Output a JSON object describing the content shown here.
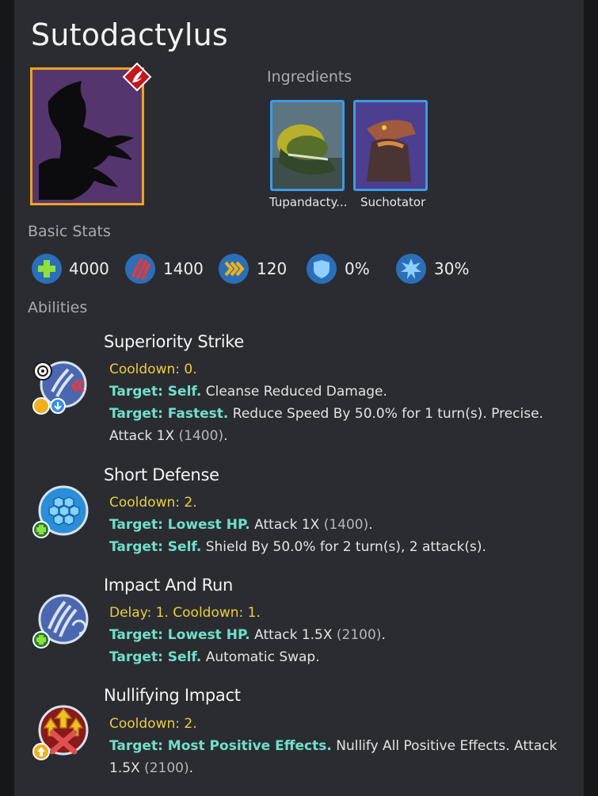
{
  "creature": {
    "name": "Sutodactylus"
  },
  "sections": {
    "ingredients": "Ingredients",
    "basic_stats": "Basic Stats",
    "abilities": "Abilities"
  },
  "ingredients": [
    {
      "name": "Tupandacty..."
    },
    {
      "name": "Suchotator"
    }
  ],
  "stats": [
    {
      "icon": "health-icon",
      "value": "4000"
    },
    {
      "icon": "attack-icon",
      "value": "1400"
    },
    {
      "icon": "speed-icon",
      "value": "120"
    },
    {
      "icon": "armor-icon",
      "value": "0%"
    },
    {
      "icon": "critical-icon",
      "value": "30%"
    }
  ],
  "abilities": [
    {
      "name": "Superiority Strike",
      "timing": "Cooldown: 0.",
      "lines": [
        {
          "target": "Target: Self.",
          "text": " Cleanse Reduced Damage.",
          "num": "",
          "tail": ""
        },
        {
          "target": "Target: Fastest.",
          "text": " Reduce Speed By 50.0% for 1 turn(s). Precise. Attack 1X ",
          "num": "(1400)",
          "tail": "."
        }
      ]
    },
    {
      "name": "Short Defense",
      "timing": "Cooldown: 2.",
      "lines": [
        {
          "target": "Target: Lowest HP.",
          "text": " Attack 1X ",
          "num": "(1400)",
          "tail": "."
        },
        {
          "target": "Target: Self.",
          "text": " Shield By 50.0% for 2 turn(s), 2 attack(s).",
          "num": "",
          "tail": ""
        }
      ]
    },
    {
      "name": "Impact And Run",
      "timing": "Delay: 1. Cooldown: 1.",
      "lines": [
        {
          "target": "Target: Lowest HP.",
          "text": " Attack 1.5X ",
          "num": "(2100)",
          "tail": "."
        },
        {
          "target": "Target: Self.",
          "text": " Automatic Swap.",
          "num": "",
          "tail": ""
        }
      ]
    },
    {
      "name": "Nullifying Impact",
      "timing": "Cooldown: 2.",
      "lines": [
        {
          "target": "Target: Most Positive Effects.",
          "text": " Nullify All Positive Effects. Attack 1.5X ",
          "num": "(2100)",
          "tail": "."
        }
      ]
    }
  ],
  "colors": {
    "legendary_border": "#f0a21e",
    "rarity_badge": "#c4161c",
    "ingredient_border": "#3a9be8",
    "cooldown_text": "#e9cf3b",
    "target_text": "#6fe0ca",
    "stat_icon_bg": "#2a6fb8"
  }
}
